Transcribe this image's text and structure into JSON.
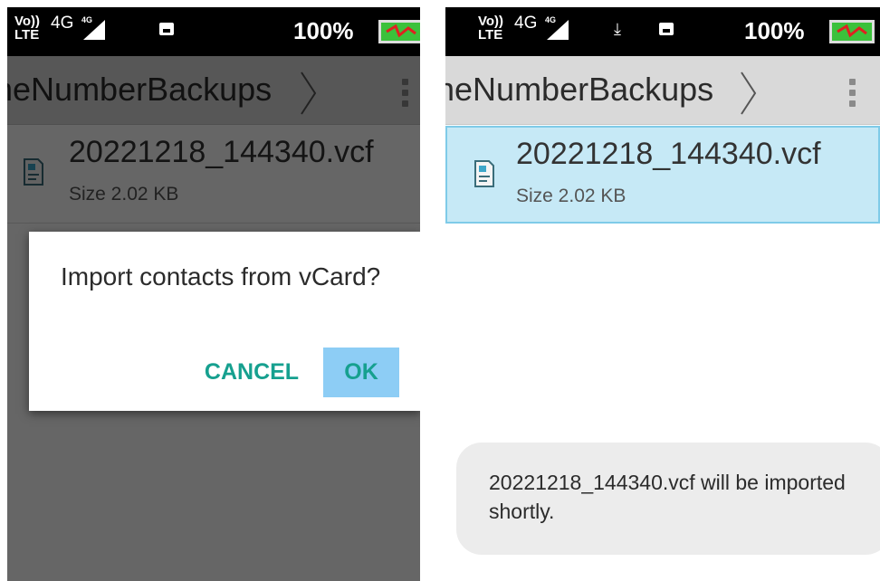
{
  "status_bar": {
    "volte_top": "Vo))",
    "volte_bottom": "LTE",
    "network_label": "4G",
    "signal_badge": "4G",
    "battery_percent": "100%",
    "icons": [
      "volte-lte-icon",
      "signal-icon",
      "download-icon",
      "gallery-icon",
      "battery-charging-icon"
    ],
    "battery_color": "#3bc13b"
  },
  "toolbar": {
    "path_segment": "neNumberBackups"
  },
  "file": {
    "name": "20221218_144340.vcf",
    "size": "Size 2.02 KB",
    "icon": "vcard-file-icon"
  },
  "dialog": {
    "message": "Import contacts from vCard?",
    "cancel_label": "CANCEL",
    "ok_label": "OK",
    "button_color": "#16a08f",
    "focus_color": "#8dcdf5"
  },
  "toast": {
    "message": "20221218_144340.vcf will be imported shortly."
  },
  "colors": {
    "selection_bg": "#c6e9f6",
    "selection_border": "#7fcbe8",
    "appbar_bg": "#d9d9d9"
  }
}
